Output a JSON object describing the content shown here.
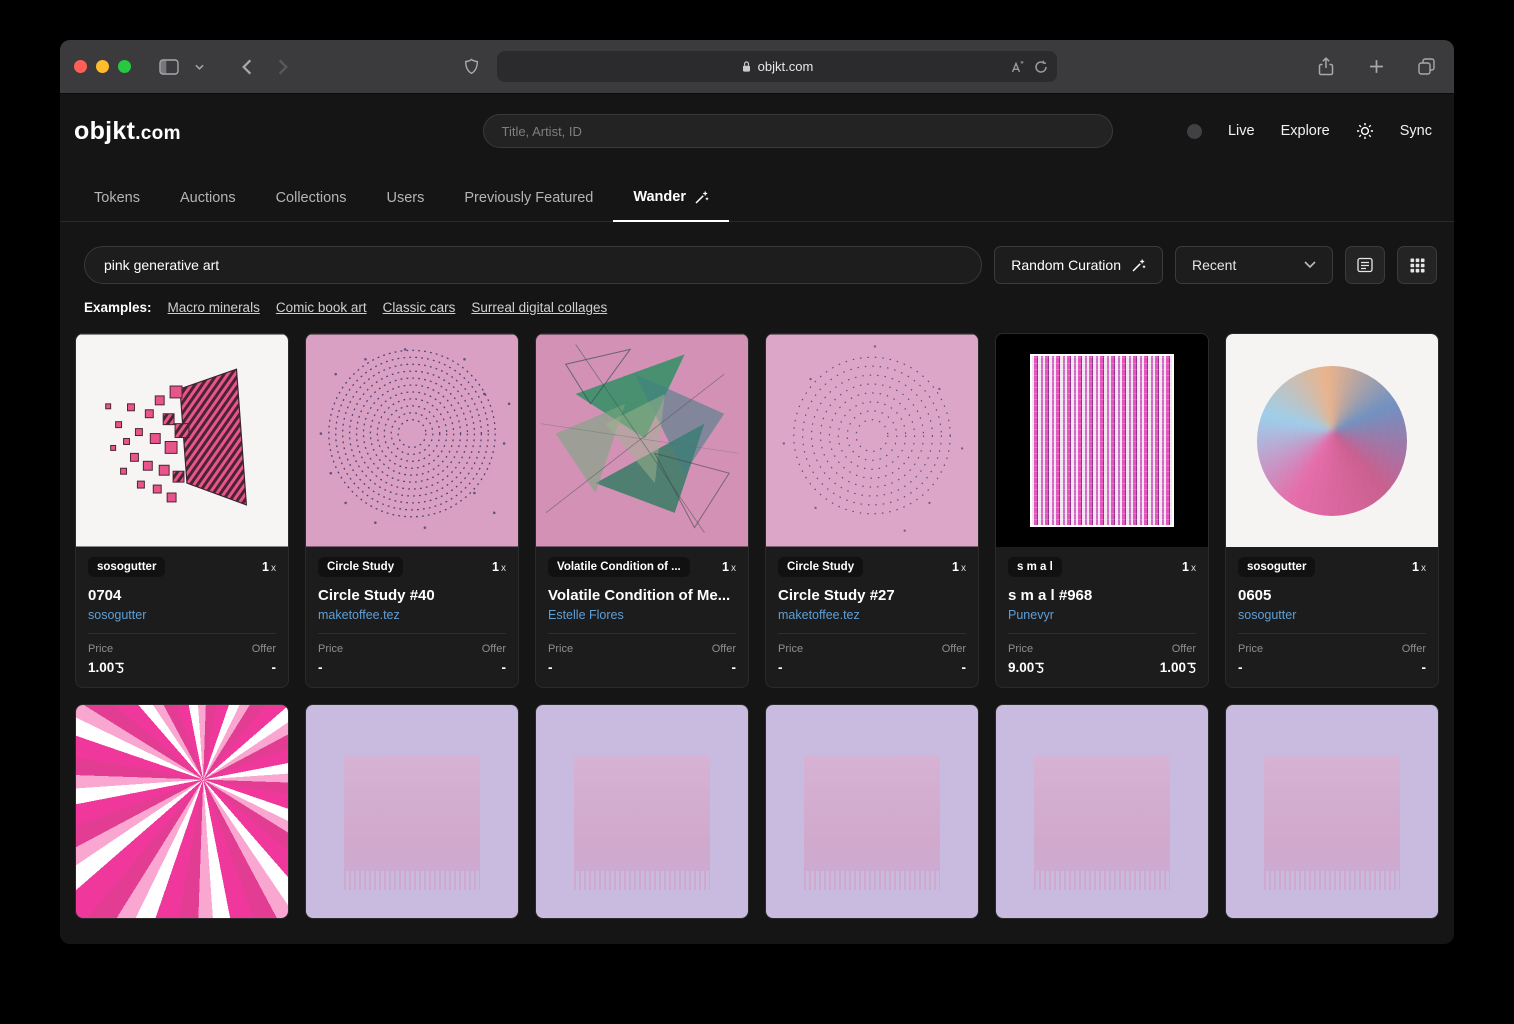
{
  "browser": {
    "url": "objkt.com"
  },
  "header": {
    "logo_main": "objkt",
    "logo_suffix": ".com",
    "search_placeholder": "Title, Artist, ID",
    "nav": {
      "live": "Live",
      "explore": "Explore",
      "sync": "Sync"
    }
  },
  "tabs": [
    {
      "label": "Tokens"
    },
    {
      "label": "Auctions"
    },
    {
      "label": "Collections"
    },
    {
      "label": "Users"
    },
    {
      "label": "Previously Featured"
    },
    {
      "label": "Wander"
    }
  ],
  "controls": {
    "query": "pink generative art",
    "random_curation_label": "Random Curation",
    "sort_value": "Recent"
  },
  "examples": {
    "label": "Examples:",
    "links": [
      "Macro minerals",
      "Comic book art",
      "Classic cars",
      "Surreal digital collages"
    ]
  },
  "currency_symbol": "ꜩ",
  "colors": {
    "artist_link": "#5f9ed6",
    "site_background": "#151515",
    "card_background": "#1c1c1d"
  },
  "cards": [
    {
      "badge": "sosogutter",
      "editions": "1",
      "editions_x": "x",
      "title": "0704",
      "artist": "sosogutter",
      "price_label": "Price",
      "offer_label": "Offer",
      "price": "1.00",
      "offer": "-"
    },
    {
      "badge": "Circle Study",
      "editions": "1",
      "editions_x": "x",
      "title": "Circle Study #40",
      "artist": "maketoffee.tez",
      "price_label": "Price",
      "offer_label": "Offer",
      "price": "-",
      "offer": "-"
    },
    {
      "badge": "Volatile Condition of ...",
      "editions": "1",
      "editions_x": "x",
      "title": "Volatile Condition of Me...",
      "artist": "Estelle Flores",
      "price_label": "Price",
      "offer_label": "Offer",
      "price": "-",
      "offer": "-"
    },
    {
      "badge": "Circle Study",
      "editions": "1",
      "editions_x": "x",
      "title": "Circle Study #27",
      "artist": "maketoffee.tez",
      "price_label": "Price",
      "offer_label": "Offer",
      "price": "-",
      "offer": "-"
    },
    {
      "badge": "s m a l",
      "editions": "1",
      "editions_x": "x",
      "title": "s m a l #968",
      "artist": "Punevyr",
      "price_label": "Price",
      "offer_label": "Offer",
      "price": "9.00",
      "offer": "1.00"
    },
    {
      "badge": "sosogutter",
      "editions": "1",
      "editions_x": "x",
      "title": "0605",
      "artist": "sosogutter",
      "price_label": "Price",
      "offer_label": "Offer",
      "price": "-",
      "offer": "-"
    }
  ]
}
